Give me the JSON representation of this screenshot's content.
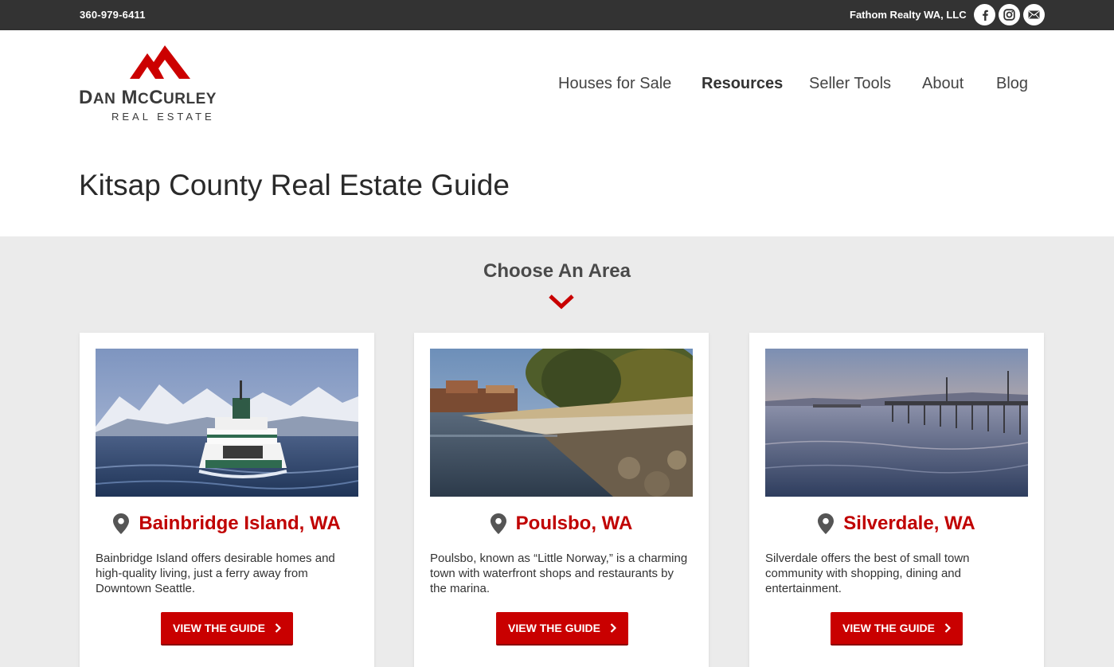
{
  "topbar": {
    "phone": "360-979-6411",
    "company": "Fathom Realty WA, LLC",
    "social": [
      "facebook-icon",
      "instagram-icon",
      "email-icon"
    ]
  },
  "logo": {
    "name": "Dan McCurley",
    "sub": "REAL ESTATE",
    "color": "#cc0000"
  },
  "nav": {
    "items": [
      {
        "label": "Houses for Sale"
      },
      {
        "label": "Resources",
        "active": true
      },
      {
        "label": "Seller Tools"
      },
      {
        "label": "About"
      },
      {
        "label": "Blog"
      }
    ]
  },
  "page": {
    "title": "Kitsap County Real Estate Guide",
    "section_title": "Choose An Area"
  },
  "cards": [
    {
      "name": "Bainbridge Island, WA",
      "description": "Bainbridge Island offers desirable homes and high-quality living, just a ferry away from Downtown Seattle.",
      "button": "VIEW THE GUIDE"
    },
    {
      "name": "Poulsbo, WA",
      "description": "Poulsbo, known as “Little Norway,” is a charming town with waterfront shops and restaurants by the marina.",
      "button": "VIEW THE GUIDE"
    },
    {
      "name": "Silverdale, WA",
      "description": "Silverdale offers the best of small town community with shopping, dining and entertainment.",
      "button": "VIEW THE GUIDE"
    }
  ],
  "colors": {
    "accent": "#c90000",
    "topbar": "#333333",
    "section_bg": "#ebebeb"
  }
}
